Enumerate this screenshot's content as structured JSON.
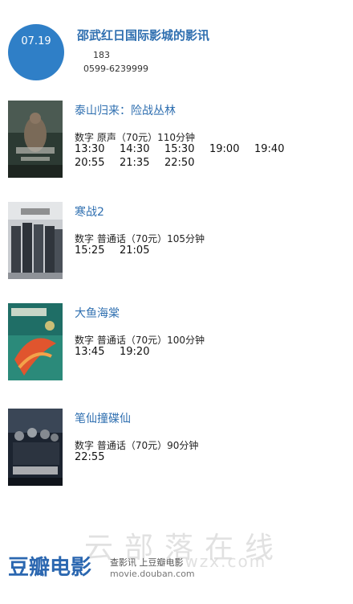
{
  "header": {
    "date": "07.19",
    "cinema_name": "邵武红日国际影城的影讯",
    "address": "183",
    "phone": "0599-6239999"
  },
  "movies": [
    {
      "title": "泰山归来：险战丛林",
      "info": "数字  原声（70元）110分钟",
      "times": [
        "13:30",
        "14:30",
        "15:30",
        "19:00",
        "19:40",
        "20:55",
        "21:35",
        "22:50"
      ]
    },
    {
      "title": "寒战2",
      "info": "数字  普通话（70元）105分钟",
      "times": [
        "15:25",
        "21:05"
      ]
    },
    {
      "title": "大鱼海棠",
      "info": "数字  普通话（70元）100分钟",
      "times": [
        "13:45",
        "19:20"
      ]
    },
    {
      "title": "笔仙撞碟仙",
      "info": "数字  普通话（70元）90分钟",
      "times": [
        "22:55"
      ]
    }
  ],
  "footer": {
    "logo": "豆瓣电影",
    "slogan": "查影讯  上豆瓣电影",
    "url": "movie.douban.com"
  },
  "watermark": {
    "text": "云部落在线",
    "url": "swzx.com"
  }
}
